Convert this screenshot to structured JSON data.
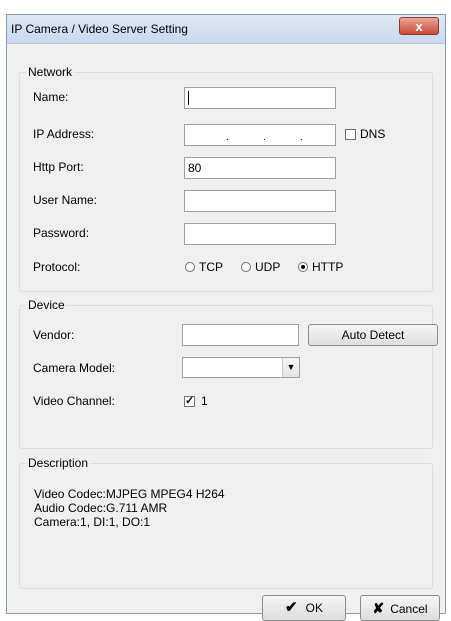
{
  "window": {
    "title": "IP Camera / Video Server Setting",
    "close_label": "x"
  },
  "network": {
    "legend": "Network",
    "name_label": "Name:",
    "name_value": "",
    "ip_label": "IP Address:",
    "ip_separator": ".",
    "dns_label": "DNS",
    "dns_checked": false,
    "port_label": "Http Port:",
    "port_value": "80",
    "user_label": "User Name:",
    "user_value": "",
    "password_label": "Password:",
    "password_value": "",
    "protocol_label": "Protocol:",
    "protocols": [
      "TCP",
      "UDP",
      "HTTP"
    ],
    "protocol_selected": "HTTP"
  },
  "device": {
    "legend": "Device",
    "vendor_label": "Vendor:",
    "vendor_value": "",
    "auto_detect_label": "Auto Detect",
    "model_label": "Camera Model:",
    "model_value": "",
    "channel_label": "Video Channel:",
    "channel_value": "1",
    "channel_checked": true
  },
  "description": {
    "legend": "Description",
    "lines": [
      "Video Codec:MJPEG MPEG4 H264",
      "Audio Codec:G.711 AMR",
      "Camera:1, DI:1, DO:1"
    ]
  },
  "buttons": {
    "ok_label": "OK",
    "cancel_label": "Cancel"
  },
  "icons": {
    "ok": "checkmark-icon",
    "cancel": "x-mark-icon",
    "dropdown": "chevron-down-icon"
  }
}
